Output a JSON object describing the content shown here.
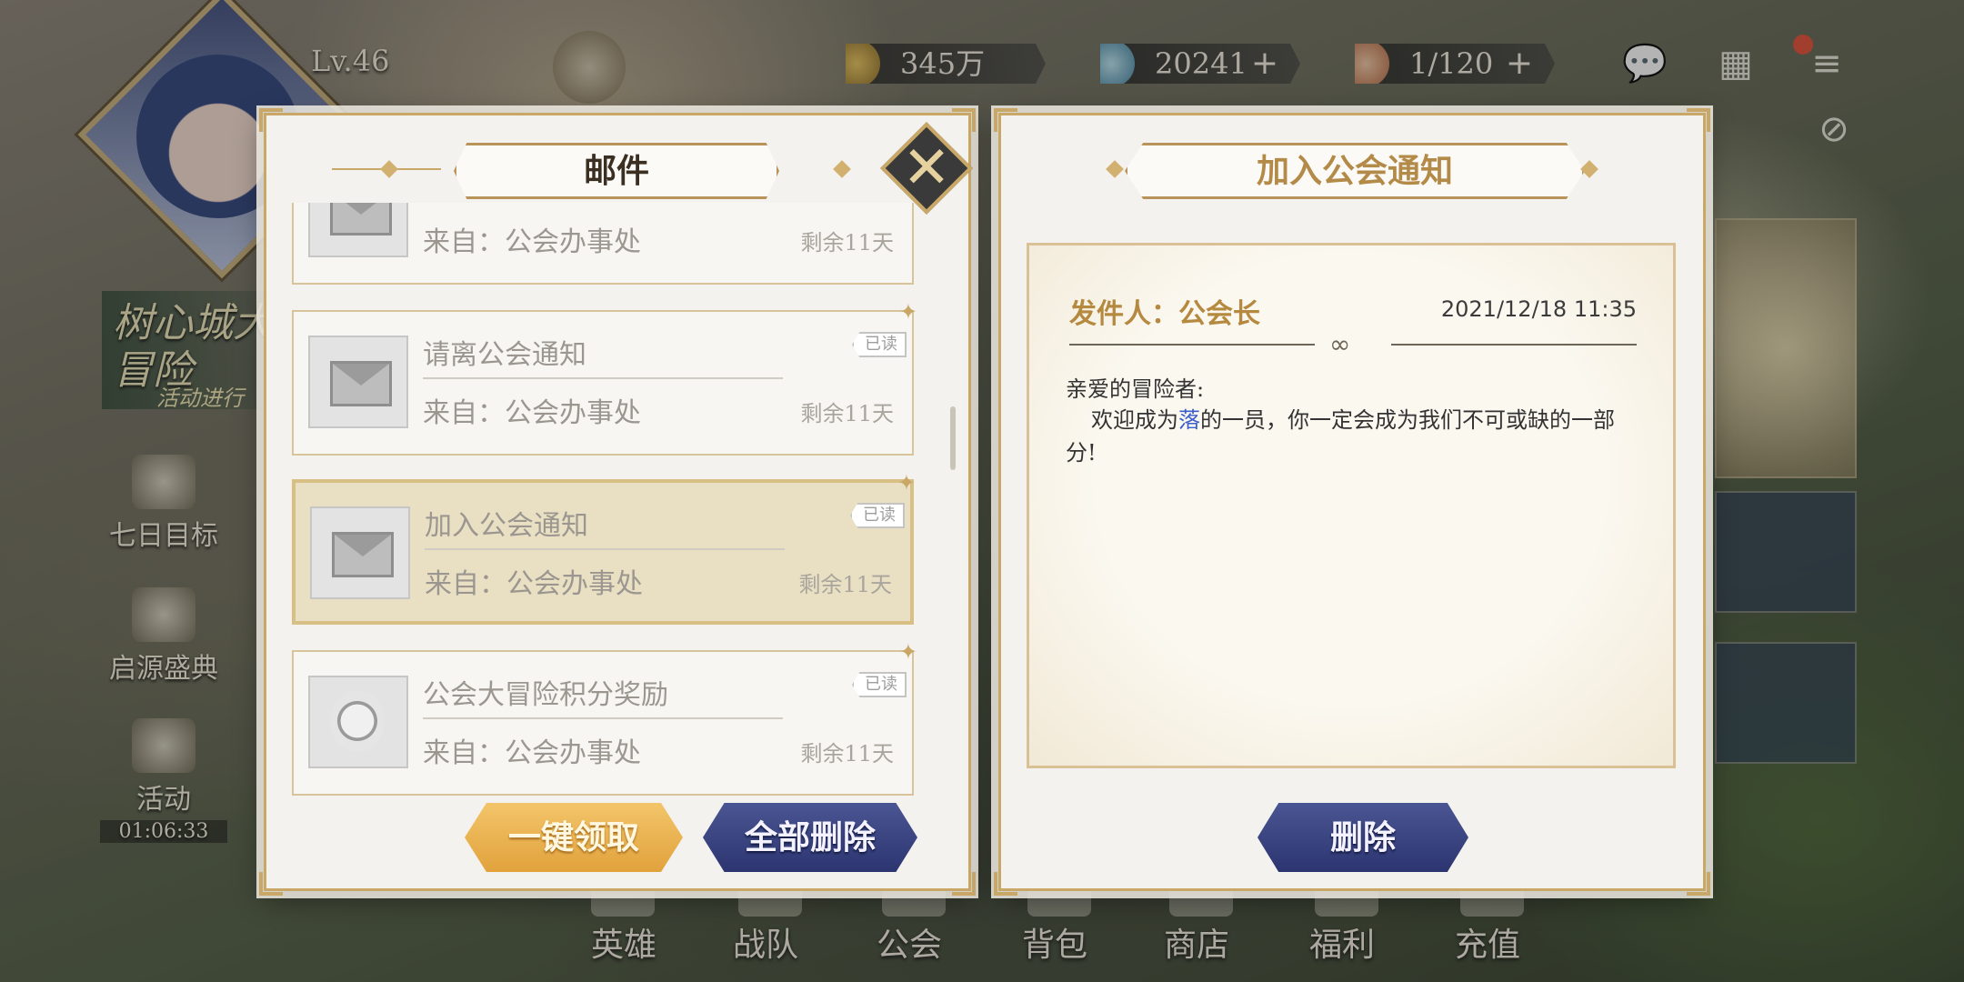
{
  "top_bar": {
    "level": "Lv.46",
    "gold": "345万",
    "gems": "20241",
    "stamina": "1/120",
    "plus_symbol": "+"
  },
  "left_menu": {
    "banner_title": "树心城大冒险",
    "banner_subtitle": "活动进行",
    "items": [
      {
        "label": "七日目标",
        "icon": "notepad-icon"
      },
      {
        "label": "启源盛典",
        "icon": "hat-icon"
      },
      {
        "label": "活动",
        "icon": "money-bag-icon",
        "timer": "01:06:33"
      }
    ]
  },
  "bottom_nav": {
    "items": [
      {
        "label": "英雄",
        "icon": "hero-icon"
      },
      {
        "label": "战队",
        "icon": "team-icon"
      },
      {
        "label": "公会",
        "icon": "guild-icon"
      },
      {
        "label": "背包",
        "icon": "backpack-icon"
      },
      {
        "label": "商店",
        "icon": "shop-icon"
      },
      {
        "label": "福利",
        "icon": "gift-icon"
      },
      {
        "label": "充值",
        "icon": "recharge-icon"
      }
    ]
  },
  "mail_panel": {
    "title": "邮件",
    "items": [
      {
        "subject": "",
        "from": "来自：公会办事处",
        "days_left": "剩余11天",
        "read": false,
        "icon": "envelope-icon"
      },
      {
        "subject": "请离公会通知",
        "from": "来自：公会办事处",
        "days_left": "剩余11天",
        "read": true,
        "read_label": "已读",
        "icon": "envelope-open-icon"
      },
      {
        "subject": "加入公会通知",
        "from": "来自：公会办事处",
        "days_left": "剩余11天",
        "read": true,
        "read_label": "已读",
        "icon": "envelope-open-icon",
        "selected": true
      },
      {
        "subject": "公会大冒险积分奖励",
        "from": "来自：公会办事处",
        "days_left": "剩余11天",
        "read": true,
        "read_label": "已读",
        "icon": "guild-emblem-icon"
      }
    ],
    "claim_all_label": "一键领取",
    "delete_all_label": "全部删除"
  },
  "detail_panel": {
    "title": "加入公会通知",
    "sender": "发件人：公会长",
    "datetime": "2021/12/18 11:35",
    "greeting": "亲爱的冒险者:",
    "body_before": "欢迎成为",
    "body_highlight": "落",
    "body_after": "的一员，你一定会成为我们不可或缺的一部分!",
    "delete_label": "删除"
  },
  "colors": {
    "gold_accent": "#c9a867",
    "title_gold_text": "#b38a48",
    "blue_button": "#2c3570",
    "orange_button": "#e1a23c",
    "highlight_blue": "#3c5ec8"
  }
}
